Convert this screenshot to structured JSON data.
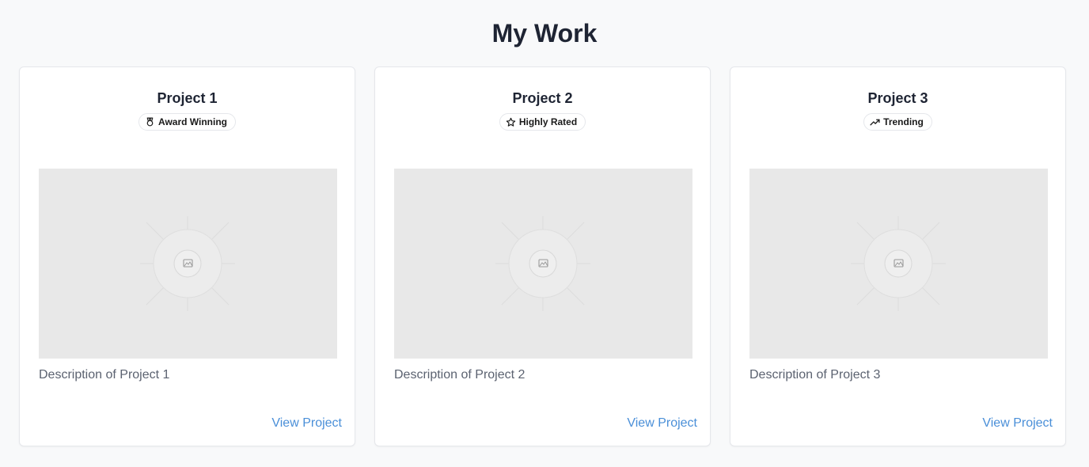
{
  "page": {
    "title": "My Work",
    "background": "#f8f9fa"
  },
  "projects": [
    {
      "title": "Project 1",
      "badge_label": "Award Winning",
      "badge_icon": "award-icon",
      "description": "Description of Project 1",
      "link_label": "View Project",
      "image_icon": "image-placeholder-icon"
    },
    {
      "title": "Project 2",
      "badge_label": "Highly Rated",
      "badge_icon": "star-icon",
      "description": "Description of Project 2",
      "link_label": "View Project",
      "image_icon": "image-placeholder-icon"
    },
    {
      "title": "Project 3",
      "badge_label": "Trending",
      "badge_icon": "trending-up-icon",
      "description": "Description of Project 3",
      "link_label": "View Project",
      "image_icon": "image-placeholder-icon"
    }
  ],
  "colors": {
    "link": "#4a8fd8",
    "title": "#1e2433",
    "description": "#5b6270",
    "image_bg": "#e8e8e8"
  }
}
